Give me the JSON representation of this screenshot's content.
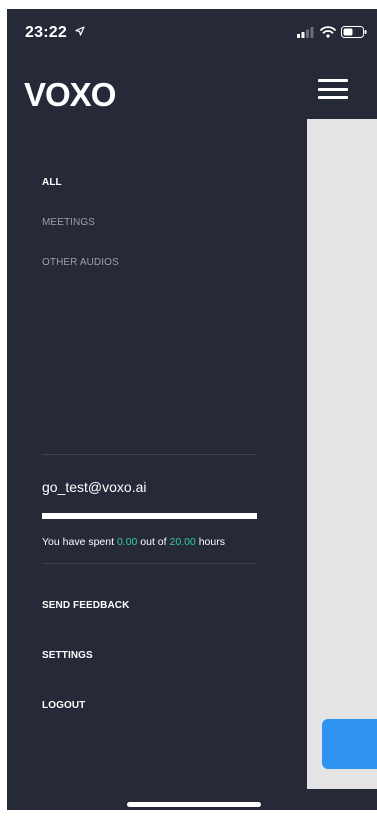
{
  "status_bar": {
    "time": "23:22",
    "location_icon": "location-arrow-icon",
    "signal_icon": "cellular-signal-icon",
    "wifi_icon": "wifi-icon",
    "battery_icon": "battery-icon"
  },
  "header": {
    "logo": "VOXO",
    "menu_icon": "hamburger-menu-icon"
  },
  "filters": [
    {
      "label": "ALL",
      "active": true
    },
    {
      "label": "MEETINGS",
      "active": false
    },
    {
      "label": "OTHER AUDIOS",
      "active": false
    }
  ],
  "account": {
    "email": "go_test@voxo.ai",
    "usage_fraction": 1.0,
    "usage_prefix": "You have spent",
    "spent": "0.00",
    "usage_middle": "out of",
    "total": "20.00",
    "usage_suffix": "hours"
  },
  "actions": [
    {
      "label": "SEND FEEDBACK"
    },
    {
      "label": "SETTINGS"
    },
    {
      "label": "LOGOUT"
    }
  ],
  "colors": {
    "drawer_bg": "#252938",
    "highlight": "#2fcf9a",
    "main_bg": "#e4e4e4",
    "accent_button": "#2d92f0"
  }
}
